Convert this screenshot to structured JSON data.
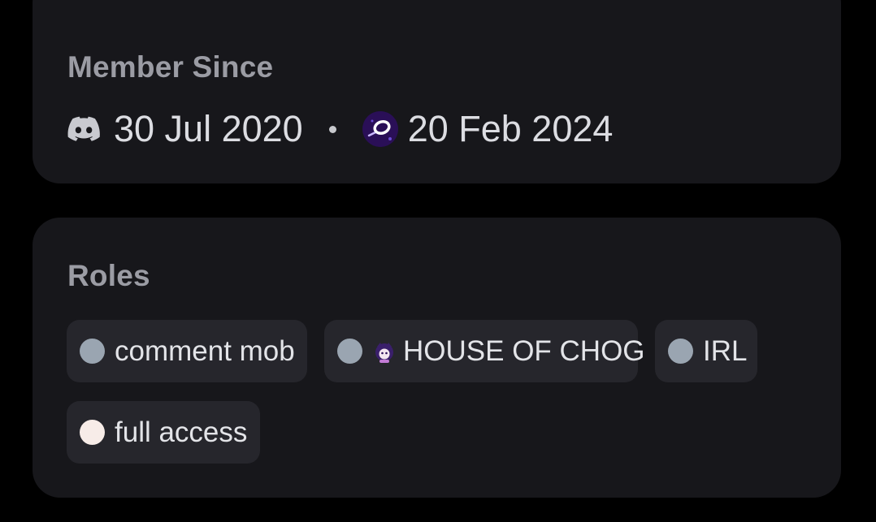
{
  "member_since": {
    "title": "Member Since",
    "discord_date": "30 Jul 2020",
    "separator": "•",
    "server_date": "20 Feb 2024"
  },
  "roles": {
    "title": "Roles",
    "items": [
      {
        "label": "comment mob",
        "color": "#9aa5b1"
      },
      {
        "label": "HOUSE OF CHOG",
        "color": "#9aa5b1",
        "icon": "chog-emoji-icon"
      },
      {
        "label": "IRL",
        "color": "#9aa5b1"
      },
      {
        "label": "full access",
        "color": "#f7ece8"
      }
    ]
  },
  "colors": {
    "background": "#000000",
    "card": "#17171b",
    "pill": "#26262c",
    "title": "#9b9ca4",
    "text": "#dcdde2"
  }
}
